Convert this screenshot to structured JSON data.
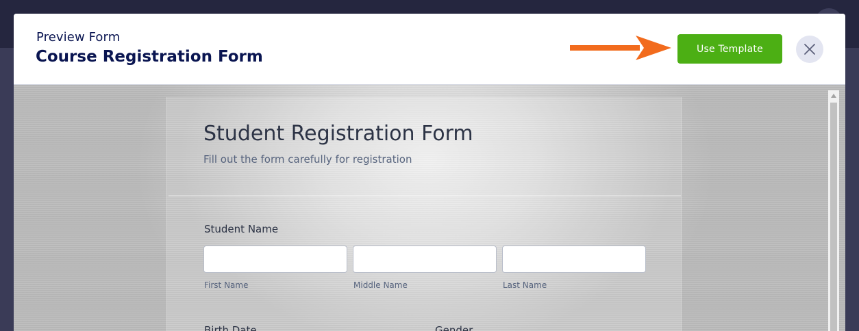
{
  "header": {
    "subtitle": "Preview Form",
    "title": "Course Registration Form",
    "use_template_label": "Use Template",
    "close_icon": "close-icon",
    "arrow_color": "#f26b1d",
    "button_color": "#4caf14"
  },
  "form": {
    "title": "Student Registration Form",
    "subtitle": "Fill out the form carefully for registration",
    "student_name": {
      "label": "Student Name",
      "first_label": "First Name",
      "middle_label": "Middle Name",
      "last_label": "Last Name"
    },
    "birth_date_label": "Birth Date",
    "gender_label": "Gender"
  }
}
